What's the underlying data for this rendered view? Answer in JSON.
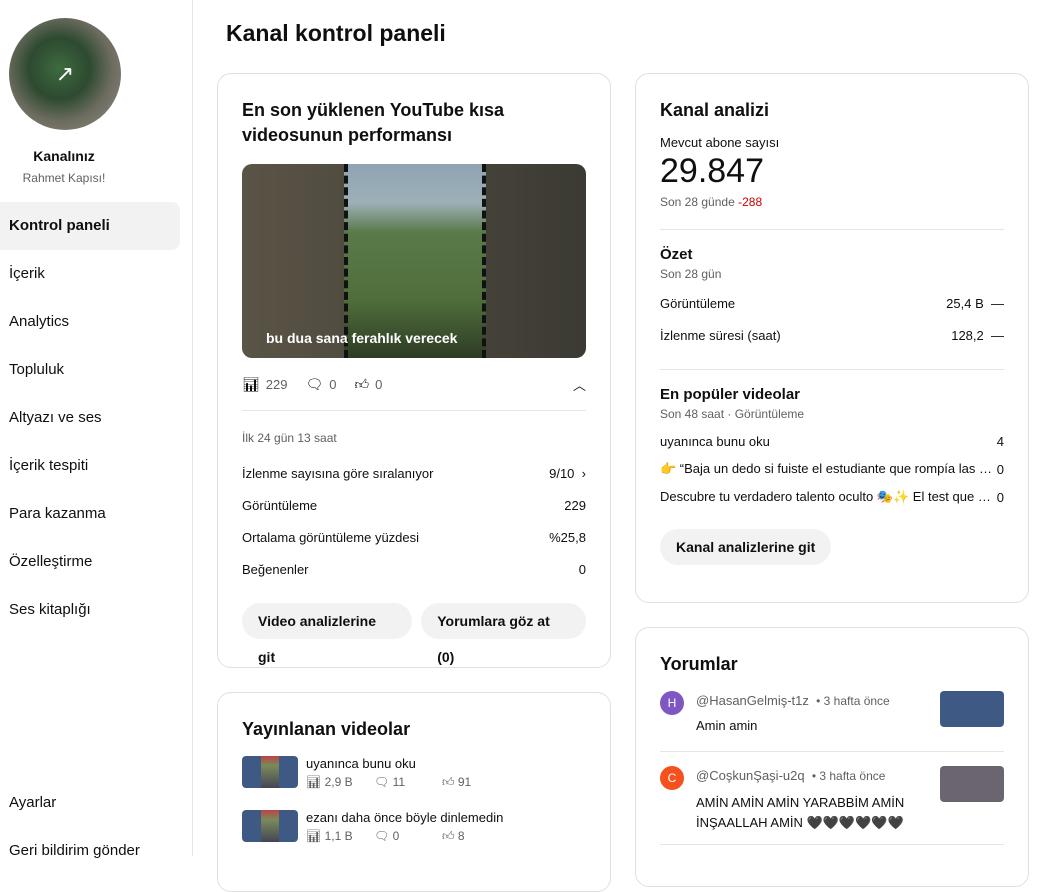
{
  "sidebar": {
    "channel_label": "Kanalınız",
    "channel_name": "Rahmet Kapısı!",
    "items": [
      {
        "label": "Kontrol paneli"
      },
      {
        "label": "İçerik"
      },
      {
        "label": "Analytics"
      },
      {
        "label": "Topluluk"
      },
      {
        "label": "Altyazı ve ses"
      },
      {
        "label": "İçerik tespiti"
      },
      {
        "label": "Para kazanma"
      },
      {
        "label": "Özelleştirme"
      },
      {
        "label": "Ses kitaplığı"
      }
    ],
    "settings": "Ayarlar",
    "feedback": "Geri bildirim gönder"
  },
  "page_title": "Kanal kontrol paneli",
  "latest_short": {
    "title": "En son yüklenen YouTube kısa videosunun performansı",
    "caption": "bu dua sana ferahlık verecek",
    "views": "229",
    "comments": "0",
    "likes": "0",
    "period": "İlk 24 gün 13 saat",
    "rows": [
      {
        "label": "İzlenme sayısına göre sıralanıyor",
        "value": "9/10"
      },
      {
        "label": "Görüntüleme",
        "value": "229"
      },
      {
        "label": "Ortalama görüntüleme yüzdesi",
        "value": "%25,8"
      },
      {
        "label": "Beğenenler",
        "value": "0"
      }
    ],
    "btn_analytics": "Video analizlerine git",
    "btn_comments": "Yorumlara göz at (0)"
  },
  "published": {
    "title": "Yayınlanan videolar",
    "videos": [
      {
        "title": "uyanınca bunu oku",
        "views": "2,9 B",
        "comments": "11",
        "likes": "91"
      },
      {
        "title": "ezanı daha önce böyle dinlemedin",
        "views": "1,1 B",
        "comments": "0",
        "likes": "8"
      }
    ]
  },
  "analytics": {
    "title": "Kanal analizi",
    "subs_label": "Mevcut abone sayısı",
    "subs": "29.847",
    "change_label": "Son 28 günde",
    "change": "-288",
    "summary_title": "Özet",
    "summary_period": "Son 28 gün",
    "summary": [
      {
        "label": "Görüntüleme",
        "value": "25,4 B",
        "trend": "—"
      },
      {
        "label": "İzlenme süresi (saat)",
        "value": "128,2",
        "trend": "—"
      }
    ],
    "top_title": "En popüler videolar",
    "top_period": "Son 48 saat · Görüntüleme",
    "top": [
      {
        "title": "uyanınca bunu oku",
        "value": "4"
      },
      {
        "title": "👉 “Baja un dedo si fuiste el estudiante que rompía las …",
        "value": "0"
      },
      {
        "title": "Descubre tu verdadero talento oculto 🎭✨ El test que …",
        "value": "0"
      }
    ],
    "button": "Kanal analizlerine git",
    "accent_negative": "#cc0000"
  },
  "comments": {
    "title": "Yorumlar",
    "items": [
      {
        "initial": "H",
        "author": "@HasanGelmiş-t1z",
        "time": "• 3 hafta önce",
        "text": "Amin amin",
        "color": "#7e57c2"
      },
      {
        "initial": "C",
        "author": "@CoşkunŞaşi-u2q",
        "time": "• 3 hafta önce",
        "text": "AMİN AMİN AMİN YARABBİM AMİN İNŞAALLAH AMİN 🖤🖤🖤🖤🖤🖤",
        "color": "#f4511e"
      }
    ]
  }
}
